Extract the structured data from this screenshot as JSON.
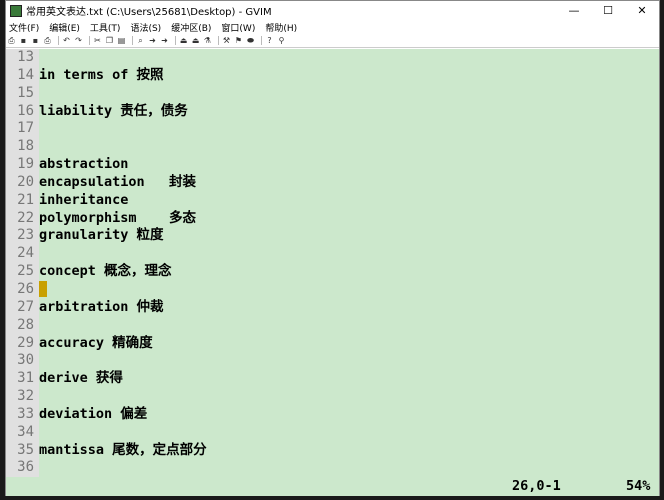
{
  "window": {
    "title": "常用英文表达.txt (C:\\Users\\25681\\Desktop) - GVIM",
    "controls": [
      "—",
      "☐",
      "✕"
    ]
  },
  "menu": [
    "文件(F)",
    "编辑(E)",
    "工具(T)",
    "语法(S)",
    "缓冲区(B)",
    "窗口(W)",
    "帮助(H)"
  ],
  "toolbar": [
    "open",
    "save",
    "save-all",
    "print",
    "undo",
    "redo",
    "cut",
    "copy",
    "paste",
    "find",
    "find-next",
    "find-prev",
    "load-session",
    "save-session",
    "run-script",
    "make",
    "ctags",
    "jump-tag",
    "help",
    "find-help"
  ],
  "lines": [
    {
      "n": "13",
      "t": ""
    },
    {
      "n": "14",
      "t": "in terms of 按照"
    },
    {
      "n": "15",
      "t": ""
    },
    {
      "n": "16",
      "t": "liability 责任，债务"
    },
    {
      "n": "17",
      "t": ""
    },
    {
      "n": "18",
      "t": ""
    },
    {
      "n": "19",
      "t": "abstraction"
    },
    {
      "n": "20",
      "t": "encapsulation   封装"
    },
    {
      "n": "21",
      "t": "inheritance"
    },
    {
      "n": "22",
      "t": "polymorphism    多态"
    },
    {
      "n": "23",
      "t": "granularity 粒度"
    },
    {
      "n": "24",
      "t": ""
    },
    {
      "n": "25",
      "t": "concept 概念，理念"
    },
    {
      "n": "26",
      "t": "",
      "cursor": true
    },
    {
      "n": "27",
      "t": "arbitration 仲裁"
    },
    {
      "n": "28",
      "t": ""
    },
    {
      "n": "29",
      "t": "accuracy 精确度"
    },
    {
      "n": "30",
      "t": ""
    },
    {
      "n": "31",
      "t": "derive 获得"
    },
    {
      "n": "32",
      "t": ""
    },
    {
      "n": "33",
      "t": "deviation 偏差"
    },
    {
      "n": "34",
      "t": ""
    },
    {
      "n": "35",
      "t": "mantissa 尾数，定点部分"
    },
    {
      "n": "36",
      "t": ""
    }
  ],
  "status": {
    "position": "26,0-1",
    "percent": "54%"
  }
}
